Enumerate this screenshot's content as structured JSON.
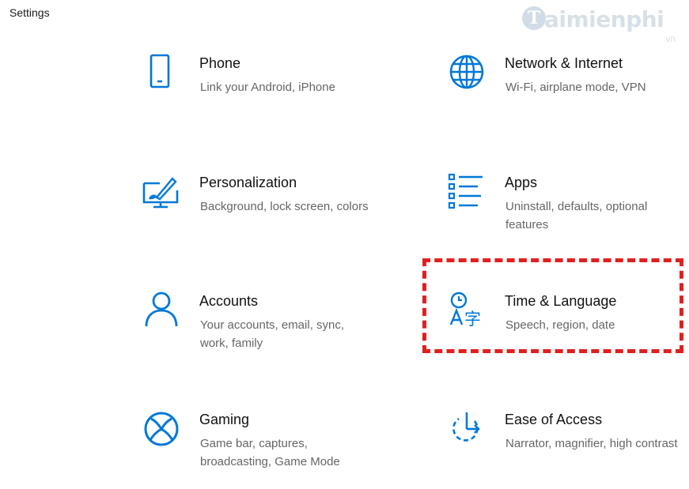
{
  "window": {
    "title": "Settings"
  },
  "watermark": {
    "letter": "T",
    "text": "aimienphi",
    "sub": ".vn"
  },
  "tiles": [
    {
      "label": "Phone",
      "desc": "Link your Android, iPhone",
      "icon": "phone-icon"
    },
    {
      "label": "Network & Internet",
      "desc": "Wi-Fi, airplane mode, VPN",
      "icon": "globe-icon"
    },
    {
      "label": "Personalization",
      "desc": "Background, lock screen, colors",
      "icon": "paintbrush-monitor-icon"
    },
    {
      "label": "Apps",
      "desc": "Uninstall, defaults, optional features",
      "icon": "apps-list-icon"
    },
    {
      "label": "Accounts",
      "desc": "Your accounts, email, sync, work, family",
      "icon": "person-icon"
    },
    {
      "label": "Time & Language",
      "desc": "Speech, region, date",
      "icon": "time-language-icon"
    },
    {
      "label": "Gaming",
      "desc": "Game bar, captures, broadcasting, Game Mode",
      "icon": "xbox-icon"
    },
    {
      "label": "Ease of Access",
      "desc": "Narrator, magnifier, high contrast",
      "icon": "ease-of-access-icon"
    }
  ],
  "colors": {
    "accent": "#0078d7",
    "highlight": "#e02020",
    "description": "#666666"
  }
}
